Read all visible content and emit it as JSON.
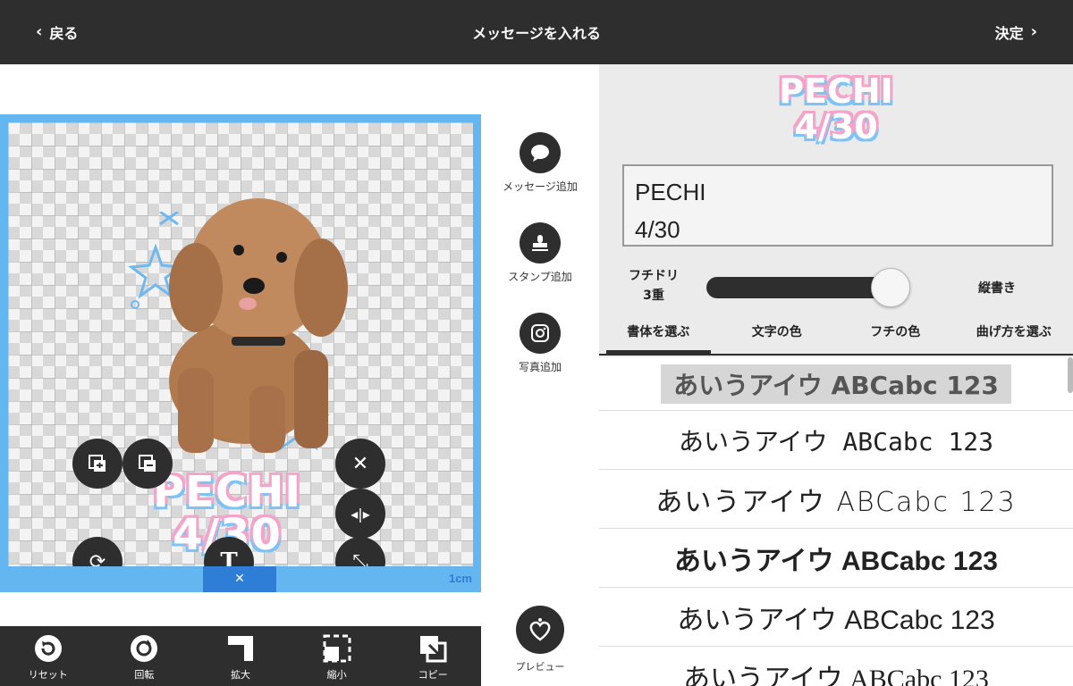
{
  "header": {
    "back_label": "戻る",
    "title": "メッセージを入れる",
    "confirm_label": "決定"
  },
  "canvas": {
    "overlay_line1": "PECHI",
    "overlay_line2": "4/30",
    "scale_label": "1cm"
  },
  "canvas_buttons": {
    "text_icon": "T"
  },
  "center": {
    "add_message": "メッセージ追加",
    "add_stamp": "スタンプ追加",
    "add_photo": "写真追加",
    "preview": "プレビュー"
  },
  "toolbar": {
    "reset": "リセット",
    "rotate": "回転",
    "enlarge": "拡大",
    "shrink": "縮小",
    "copy": "コピー"
  },
  "right": {
    "preview_line1": "PECHI",
    "preview_line2": "4/30",
    "text_value": "PECHI\n4/30",
    "outline_label_1": "フチドリ",
    "outline_label_2": "3重",
    "vertical_label": "縦書き",
    "tabs": [
      "書体を選ぶ",
      "文字の色",
      "フチの色",
      "曲げ方を選ぶ"
    ],
    "font_samples": [
      "あいうアイウ ABCabc 123",
      "あいうアイウ ABCabc 123",
      "あいうアイウ ABCabc 123",
      "あいうアイウ ABCabc 123",
      "あいうアイウ ABCabc 123",
      "あいうアイウ ABCabc 123"
    ]
  },
  "colors": {
    "dark": "#2e2e2e",
    "canvas_border": "#64b6f0",
    "accent_pink": "#f5a3c8",
    "accent_blue": "#7ec3f5"
  },
  "icons": [
    "chevron-left-icon",
    "chevron-right-icon",
    "speech-bubble-icon",
    "stamp-icon",
    "camera-icon",
    "heart-icon",
    "reset-icon",
    "rotate-icon",
    "enlarge-icon",
    "shrink-icon",
    "copy-icon"
  ]
}
